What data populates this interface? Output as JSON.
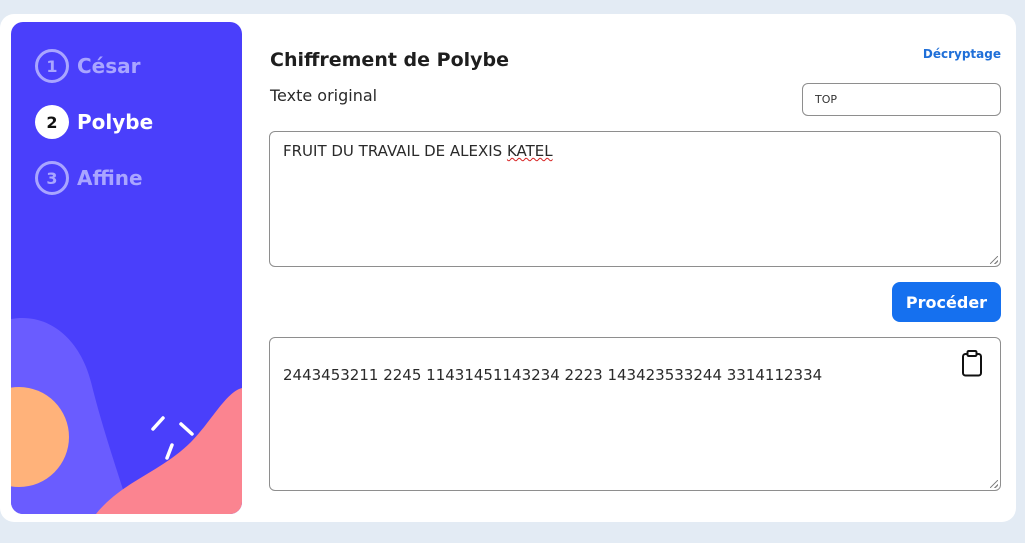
{
  "sidebar": {
    "steps": [
      {
        "number": "1",
        "label": "César",
        "active": false
      },
      {
        "number": "2",
        "label": "Polybe",
        "active": true
      },
      {
        "number": "3",
        "label": "Affine",
        "active": false
      }
    ]
  },
  "main": {
    "title": "Chiffrement de Polybe",
    "decrypt_link": "Décryptage",
    "original_label": "Texte original",
    "key_value": "TOP",
    "input_prefix": "FRUIT DU TRAVAIL DE ALEXIS ",
    "input_flagged_word": "KATEL",
    "proceed_label": "Procéder",
    "output_text": "2443453211 2245 11431451143234 2223 143423533244 3314112334"
  },
  "colors": {
    "sidebar_bg": "#4a3ffb",
    "accent_button": "#1570ef",
    "link": "#1f6fd8"
  },
  "icons": [
    "clipboard-icon"
  ]
}
